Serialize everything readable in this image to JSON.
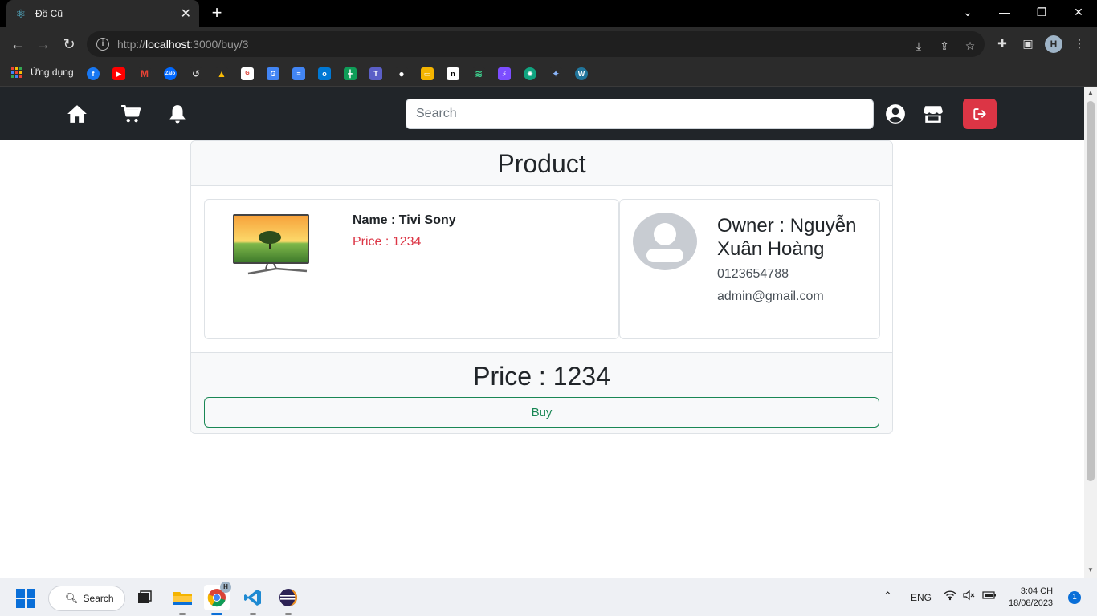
{
  "browser": {
    "tab_title": "Đồ Cũ",
    "url_scheme": "http://",
    "url_host": "localhost",
    "url_path": ":3000/buy/3",
    "bookmarks_label": "Ứng dụng",
    "profile_initial": "H"
  },
  "navbar": {
    "search_placeholder": "Search"
  },
  "product": {
    "header": "Product",
    "name": "Name : Tivi Sony",
    "price": "Price : 1234"
  },
  "owner": {
    "name": "Owner : Nguyễn Xuân Hoàng",
    "phone": "0123654788",
    "email": "admin@gmail.com"
  },
  "footer": {
    "price": "Price : 1234",
    "buy_label": "Buy"
  },
  "taskbar": {
    "search_label": "Search",
    "language": "ENG",
    "time": "3:04 CH",
    "date": "18/08/2023",
    "notification_count": "1",
    "chrome_badge": "H"
  },
  "colors": {
    "navbar_bg": "#212529",
    "danger": "#dc3545",
    "success": "#198754"
  }
}
